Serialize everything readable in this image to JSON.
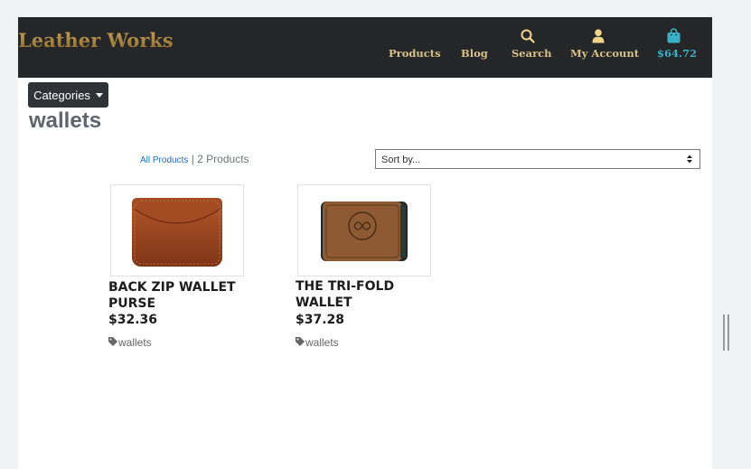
{
  "brand": "Leather Works",
  "nav": {
    "products": "Products",
    "blog": "Blog",
    "search": "Search",
    "account": "My Account",
    "cart_total": "$64.72"
  },
  "categories_button": "Categories",
  "page_title": "wallets",
  "breadcrumb": {
    "all_products": "All Products",
    "separator": "|",
    "count": "2 Products"
  },
  "sort": {
    "selected": "Sort by..."
  },
  "products": [
    {
      "name": "BACK ZIP WALLET PURSE",
      "price": "$32.36",
      "tag": "wallets"
    },
    {
      "name": "THE TRI-FOLD WALLET",
      "price": "$37.28",
      "tag": "wallets"
    }
  ],
  "colors": {
    "navbar": "#252627",
    "nav_link": "#d9c08a",
    "cart_accent": "#3ab1c8",
    "brand": "#a8843f"
  }
}
